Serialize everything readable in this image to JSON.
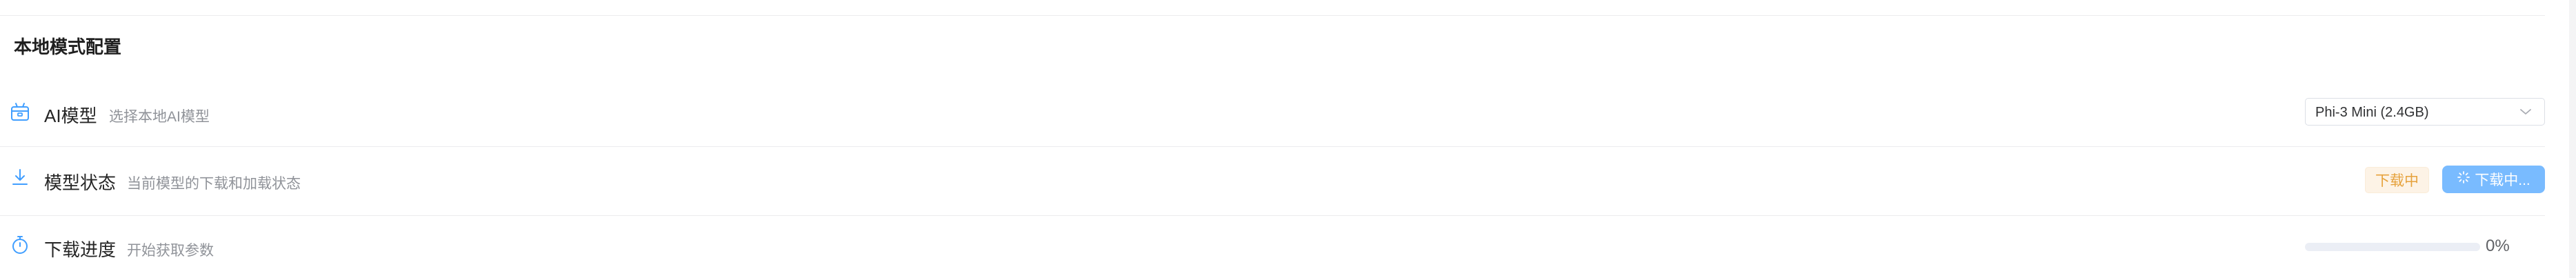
{
  "section": {
    "title": "本地模式配置"
  },
  "rows": {
    "model": {
      "icon": "box-icon",
      "label": "AI模型",
      "description": "选择本地AI模型",
      "select_value": "Phi-3 Mini (2.4GB)"
    },
    "status": {
      "icon": "download-icon",
      "label": "模型状态",
      "description": "当前模型的下载和加载状态",
      "status_tag": "下载中",
      "action_button": "下载中..."
    },
    "progress": {
      "icon": "stopwatch-icon",
      "label": "下载进度",
      "description": "开始获取参数",
      "value": 0,
      "value_text": "0%"
    }
  },
  "colors": {
    "accent": "#409eff",
    "button_disabled": "#79bbff",
    "warning": "#e6a23c",
    "warning_bg": "#fdf3e6"
  }
}
